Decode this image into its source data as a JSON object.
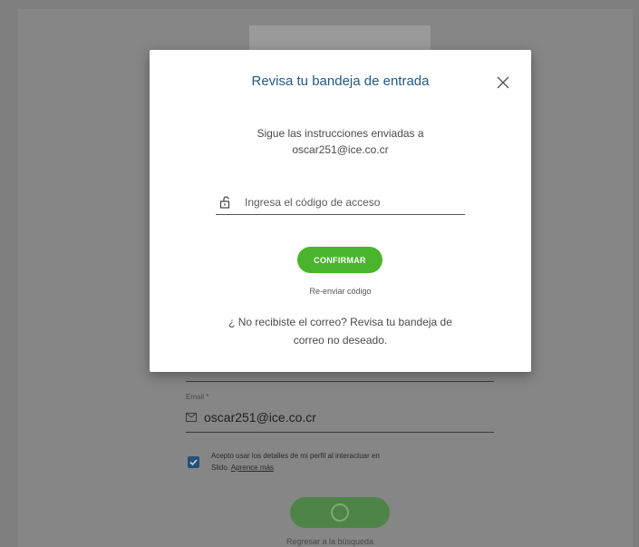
{
  "background": {
    "email_label": "Email *",
    "email_value": "oscar251@ice.co.cr",
    "consent_text": "Acepto usar los detalles de mi perfil al interactuar en",
    "consent_text_2": "Slido.",
    "learn_more_link": "Aprence más",
    "back_link": "Regresar a la búsqueda",
    "checkbox_checked": true
  },
  "modal": {
    "title": "Revisa tu bandeja de entrada",
    "instructions_line1": "Sigue las instrucciones enviadas a",
    "instructions_line2": "oscar251@ice.co.cr",
    "code_placeholder": "Ingresa el código de acceso",
    "confirm_label": "CONFIRMAR",
    "resend_label": "Re-enviar código",
    "spam_note_line1": "¿ No recibiste el correo? Revisa tu bandeja de",
    "spam_note_line2": "correo no deseado."
  },
  "colors": {
    "title_blue": "#1f5a87",
    "confirm_green": "#4ab52c",
    "overlay_gray": "#868686"
  },
  "icons": {
    "close": "close-icon",
    "lock": "lock-icon",
    "mail": "mail-icon",
    "check": "check-icon"
  }
}
